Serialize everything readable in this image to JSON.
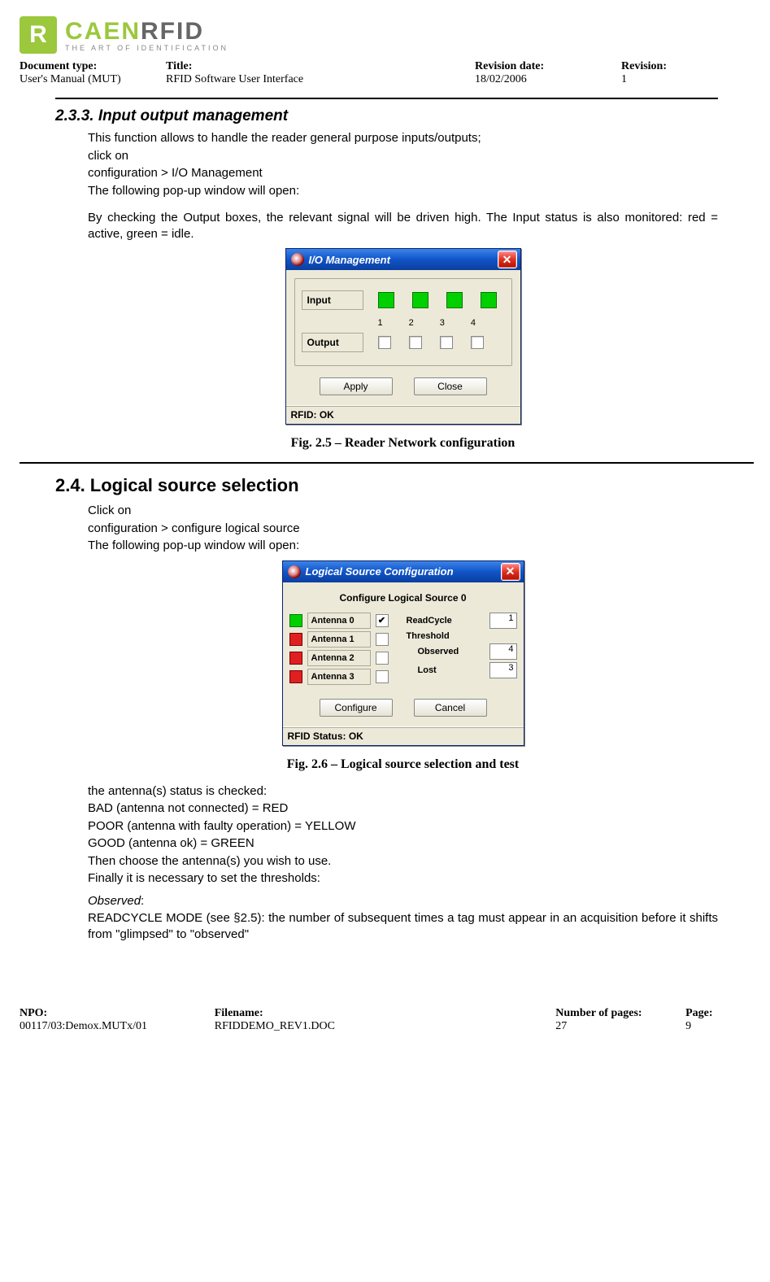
{
  "logo": {
    "badge": "R",
    "main_a": "CAEN",
    "main_b": "RFID",
    "sub": "THE  ART  OF  IDENTIFICATION"
  },
  "header": {
    "doc_type_lbl": "Document type:",
    "doc_type_val": "User's Manual (MUT)",
    "title_lbl": "Title:",
    "title_val": "RFID Software User Interface",
    "rev_date_lbl": "Revision date:",
    "rev_date_val": "18/02/2006",
    "rev_lbl": "Revision:",
    "rev_val": "1"
  },
  "sec233": {
    "heading": "2.3.3.     Input output management",
    "p1": "This function allows to handle the reader general purpose inputs/outputs;",
    "p2": "click on",
    "p3": "configuration > I/O Management",
    "p4": "The following pop-up window will open:",
    "p5": "By checking the Output boxes, the relevant signal will be driven high. The Input status is also monitored: red = active, green = idle.",
    "caption": "Fig. 2.5 – Reader Network configuration"
  },
  "io_dialog": {
    "title": "I/O Management",
    "input_lbl": "Input",
    "output_lbl": "Output",
    "col1": "1",
    "col2": "2",
    "col3": "3",
    "col4": "4",
    "apply": "Apply",
    "close": "Close",
    "status": "RFID: OK"
  },
  "sec24": {
    "heading": "2.4.    Logical source selection",
    "p1": "Click on",
    "p2": "configuration > configure logical source",
    "p3": "The following pop-up window will open:",
    "caption": "Fig. 2.6 – Logical source selection and test",
    "p4": "the antenna(s) status is checked:",
    "p5": "BAD (antenna not connected) = RED",
    "p6": "POOR (antenna with faulty operation) = YELLOW",
    "p7": "GOOD (antenna ok) = GREEN",
    "p8": "Then choose the antenna(s) you wish to use.",
    "p9": "Finally it is necessary to set the thresholds:",
    "p10a": "Observed",
    "p10b": ":",
    "p11": "READCYCLE MODE (see §2.5): the number of subsequent times a tag must appear in an acquisition before it shifts from \"glimpsed\" to \"observed\""
  },
  "ls_dialog": {
    "title": "Logical Source Configuration",
    "header": "Configure Logical Source 0",
    "ant0": "Antenna 0",
    "ant1": "Antenna 1",
    "ant2": "Antenna 2",
    "ant3": "Antenna 3",
    "check": "✔",
    "readcycle": "ReadCycle",
    "readcycle_val": "1",
    "threshold": "Threshold",
    "observed": "Observed",
    "observed_val": "4",
    "lost": "Lost",
    "lost_val": "3",
    "configure": "Configure",
    "cancel": "Cancel",
    "status": "RFID Status: OK"
  },
  "footer": {
    "npo_lbl": "NPO:",
    "npo_val": "00117/03:Demox.MUTx/01",
    "file_lbl": "Filename:",
    "file_val": "RFIDDEMO_REV1.DOC",
    "np_lbl": "Number of pages:",
    "np_val": "27",
    "page_lbl": "Page:",
    "page_val": "9"
  }
}
